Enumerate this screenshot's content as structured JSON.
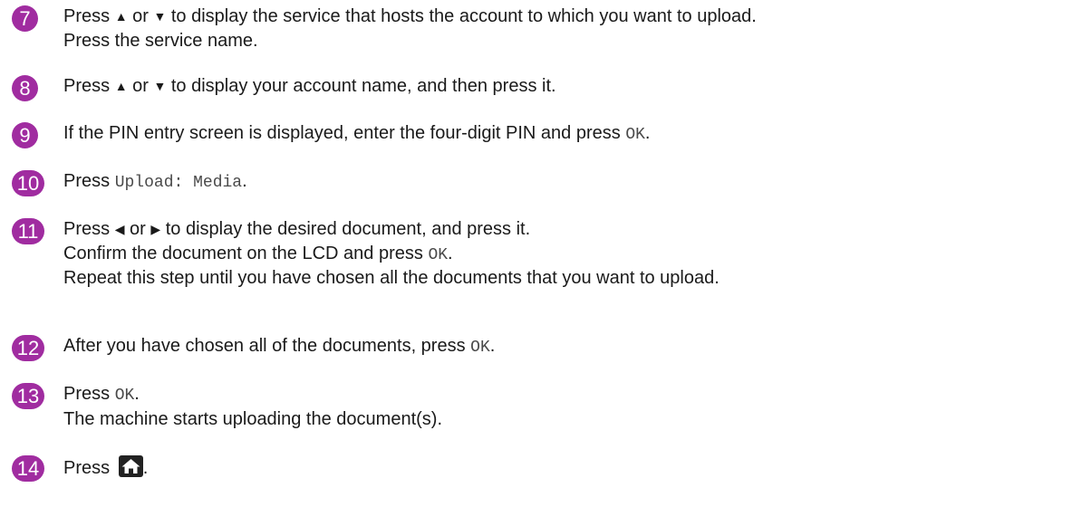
{
  "steps": [
    {
      "number": "7",
      "lines": [
        [
          {
            "t": "Press "
          },
          {
            "t": "▲",
            "glyph": "up-arrow"
          },
          {
            "t": " or "
          },
          {
            "t": "▼",
            "glyph": "down-arrow"
          },
          {
            "t": " to display the service that hosts the account to which you want to upload."
          }
        ],
        [
          {
            "t": "Press the service name."
          }
        ]
      ]
    },
    {
      "number": "8",
      "lines": [
        [
          {
            "t": "Press "
          },
          {
            "t": "▲",
            "glyph": "up-arrow"
          },
          {
            "t": " or "
          },
          {
            "t": "▼",
            "glyph": "down-arrow"
          },
          {
            "t": " to display your account name, and then press it."
          }
        ]
      ]
    },
    {
      "number": "9",
      "lines": [
        [
          {
            "t": "If the PIN entry screen is displayed, enter the four-digit PIN and press "
          },
          {
            "t": "OK",
            "mono": true
          },
          {
            "t": "."
          }
        ]
      ]
    },
    {
      "number": "10",
      "lines": [
        [
          {
            "t": "Press "
          },
          {
            "t": "Upload: Media",
            "mono": true
          },
          {
            "t": "."
          }
        ]
      ]
    },
    {
      "number": "11",
      "lines": [
        [
          {
            "t": "Press "
          },
          {
            "t": "◀",
            "glyph": "left-arrow"
          },
          {
            "t": " or "
          },
          {
            "t": "▶",
            "glyph": "right-arrow"
          },
          {
            "t": " to display the desired document, and press it."
          }
        ],
        [
          {
            "t": "Confirm the document on the LCD and press "
          },
          {
            "t": "OK",
            "mono": true
          },
          {
            "t": "."
          }
        ],
        [
          {
            "t": "Repeat this step until you have chosen all the documents that you want to upload."
          }
        ]
      ]
    },
    {
      "number": "12",
      "lines": [
        [
          {
            "t": "After you have chosen all of the documents, press "
          },
          {
            "t": "OK",
            "mono": true
          },
          {
            "t": "."
          }
        ]
      ]
    },
    {
      "number": "13",
      "lines": [
        [
          {
            "t": "Press "
          },
          {
            "t": "OK",
            "mono": true
          },
          {
            "t": "."
          }
        ],
        [
          {
            "t": "The machine starts uploading the document(s)."
          }
        ]
      ]
    },
    {
      "number": "14",
      "lines": [
        [
          {
            "t": "Press "
          },
          {
            "icon": "home-icon"
          },
          {
            "t": "."
          }
        ]
      ]
    }
  ],
  "colors": {
    "accent": "#a02ca0",
    "text": "#1a1a1a",
    "mono_text": "#4a4a4a"
  }
}
